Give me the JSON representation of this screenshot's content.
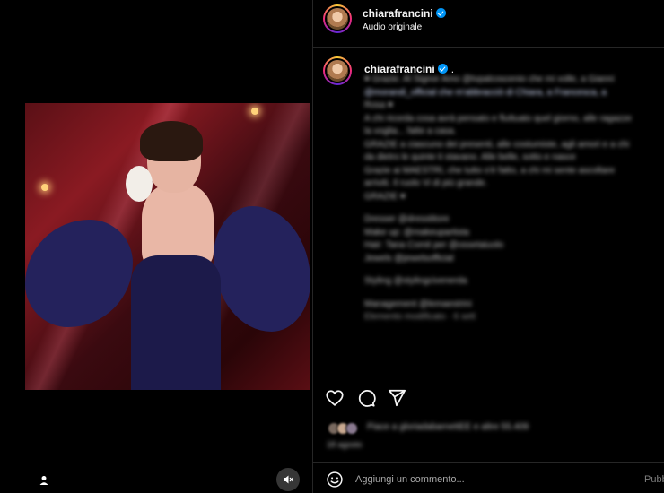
{
  "post": {
    "username": "chiarafrancini",
    "audio_label": "Audio originale",
    "verified_icon": "verified-badge-icon"
  },
  "media": {
    "description_icon": "user-tag-icon",
    "mute_icon": "speaker-muted-icon"
  },
  "caption": {
    "username": "chiarafrancini",
    "trailing": ".",
    "lines_blurred": [
      "♥ Grazie. Al Signor Amo @tvpalcoscenio che mi volle, a Gianni",
      "@morandi_official che m'abbracciò di Chiara, a Francesca, a",
      "Rosa ♥",
      "A chi ricorda cosa avrà pensato e fluttuato quel giorno, alle ragazze",
      "la voglia... fatte a casa.",
      "GRAZIE a ciascuno dei presenti, alle costumiste, agli amori e a chi",
      "da dietro le quinte ti stavano. Alle belle, sotto e nasce",
      "Grazie ai MAESTRI, che tutto s'è fatto, a chi mi sente ascoltare",
      "arriviti. Il ruolo Vi di più grande.",
      "GRAZIE ♥",
      "",
      "Dresser @dresstitore",
      "Make up: @makeupartista",
      "Hair: Tana Comit per @ossetaiuolo",
      "Jewels @jewelsofficial",
      "",
      "Styling @stylingcivenerda",
      "",
      "Management @lemaestrini"
    ],
    "edited_line": "Elemento modificato · 6 sett"
  },
  "actions": {
    "like_icon": "heart-icon",
    "comment_icon": "comment-bubble-icon",
    "share_icon": "send-paper-plane-icon"
  },
  "likes": {
    "text": "Piace a gloriadabarnettEE e altre 55.409",
    "time_label": "18 agosto"
  },
  "comment": {
    "placeholder": "Aggiungi un commento...",
    "publish_label": "Pubblica",
    "emoji_icon": "smiley-icon"
  },
  "colors": {
    "background": "#000000",
    "border": "#262626",
    "verified_blue": "#0095f6",
    "muted_text": "#a8a8a8"
  }
}
